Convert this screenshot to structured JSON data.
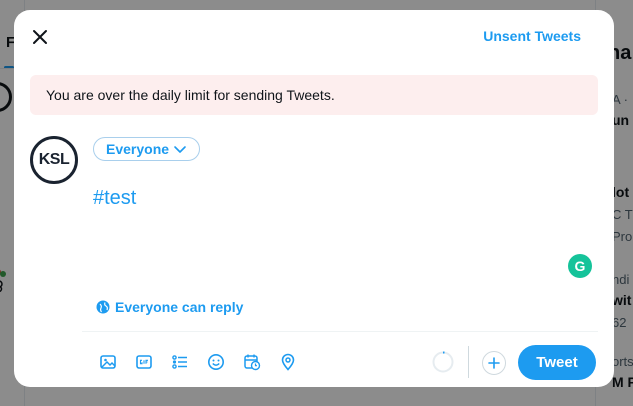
{
  "background": {
    "tab_letter": "F",
    "trends_title": "ha",
    "trends": [
      {
        "text": "A ·",
        "bold": false
      },
      {
        "text": "un",
        "bold": true
      },
      {
        "text": "lot",
        "bold": true
      },
      {
        "text": "C T",
        "bold": false
      },
      {
        "text": "Pro",
        "bold": false
      },
      {
        "text": "ndi",
        "bold": false
      },
      {
        "text": "wit",
        "bold": true
      },
      {
        "text": "62",
        "bold": false
      },
      {
        "text": "orts",
        "bold": false
      },
      {
        "text": "M P",
        "bold": true
      }
    ]
  },
  "modal": {
    "unsent_label": "Unsent Tweets",
    "warning": "You are over the daily limit for sending Tweets.",
    "avatar_text": "KSL",
    "audience_label": "Everyone",
    "tweet_text": "#test",
    "grammarly_letter": "G",
    "reply_label": "Everyone can reply",
    "tweet_button": "Tweet",
    "toolbar_icons": [
      "image-icon",
      "gif-icon",
      "poll-icon",
      "emoji-icon",
      "schedule-icon",
      "location-icon"
    ]
  },
  "colors": {
    "accent": "#1d9bf0",
    "warning_bg": "#fdeeee",
    "grammarly": "#15c39a"
  }
}
